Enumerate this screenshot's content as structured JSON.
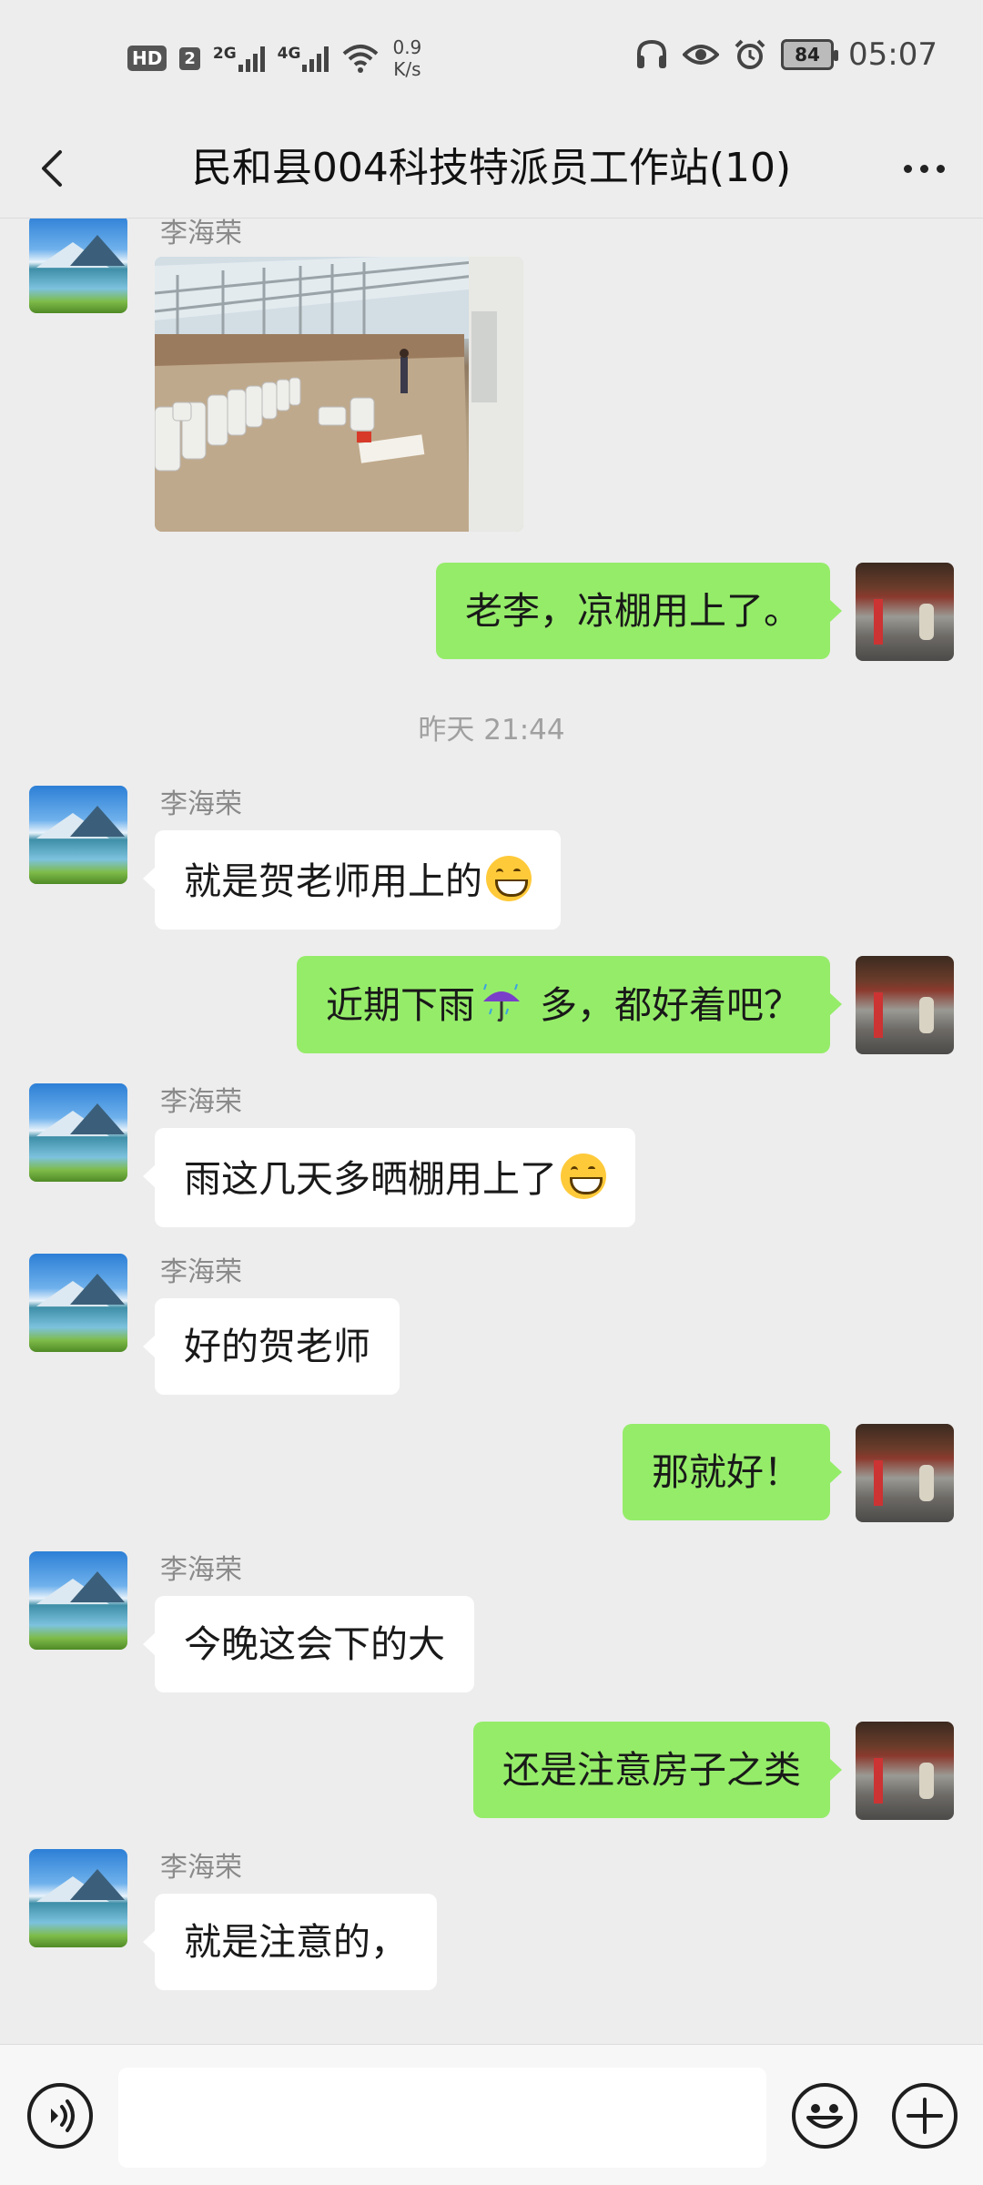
{
  "status_bar": {
    "hd_label": "HD",
    "sim_label": "2",
    "net1": "2G",
    "net2": "4G",
    "speed_value": "0.9",
    "speed_unit": "K/s",
    "battery": "84",
    "time": "05:07"
  },
  "header": {
    "title": "民和县004科技特派员工作站(10)",
    "back_icon": "chevron-left-icon",
    "more_icon": "more-dots-icon"
  },
  "messages": [
    {
      "direction": "in",
      "sender": "李海荣",
      "type": "image",
      "image_desc_icon": "photo-greenhouse"
    },
    {
      "direction": "out",
      "text": "老李，凉棚用上了。"
    },
    {
      "type": "time",
      "text": "昨天 21:44"
    },
    {
      "direction": "in",
      "sender": "李海荣",
      "text": "就是贺老师用上的",
      "emoji": "grinning-face-icon"
    },
    {
      "direction": "out",
      "text_before": "近期下雨",
      "text_after": " 多，都好着吧？",
      "emoji": "umbrella-rain-icon"
    },
    {
      "direction": "in",
      "sender": "李海荣",
      "text": "雨这几天多晒棚用上了",
      "emoji": "grinning-face-icon"
    },
    {
      "direction": "in",
      "sender": "李海荣",
      "text": "好的贺老师"
    },
    {
      "direction": "out",
      "text": "那就好！"
    },
    {
      "direction": "in",
      "sender": "李海荣",
      "text": "今晚这会下的大"
    },
    {
      "direction": "out",
      "text": "还是注意房子之类"
    },
    {
      "direction": "in",
      "sender": "李海荣",
      "text": "就是注意的，"
    }
  ],
  "input_bar": {
    "voice_icon": "voice-icon",
    "emoji_icon": "emoji-icon",
    "plus_icon": "plus-icon",
    "placeholder": ""
  },
  "colors": {
    "background": "#ededed",
    "outgoing_bubble": "#95ec69",
    "incoming_bubble": "#ffffff"
  }
}
